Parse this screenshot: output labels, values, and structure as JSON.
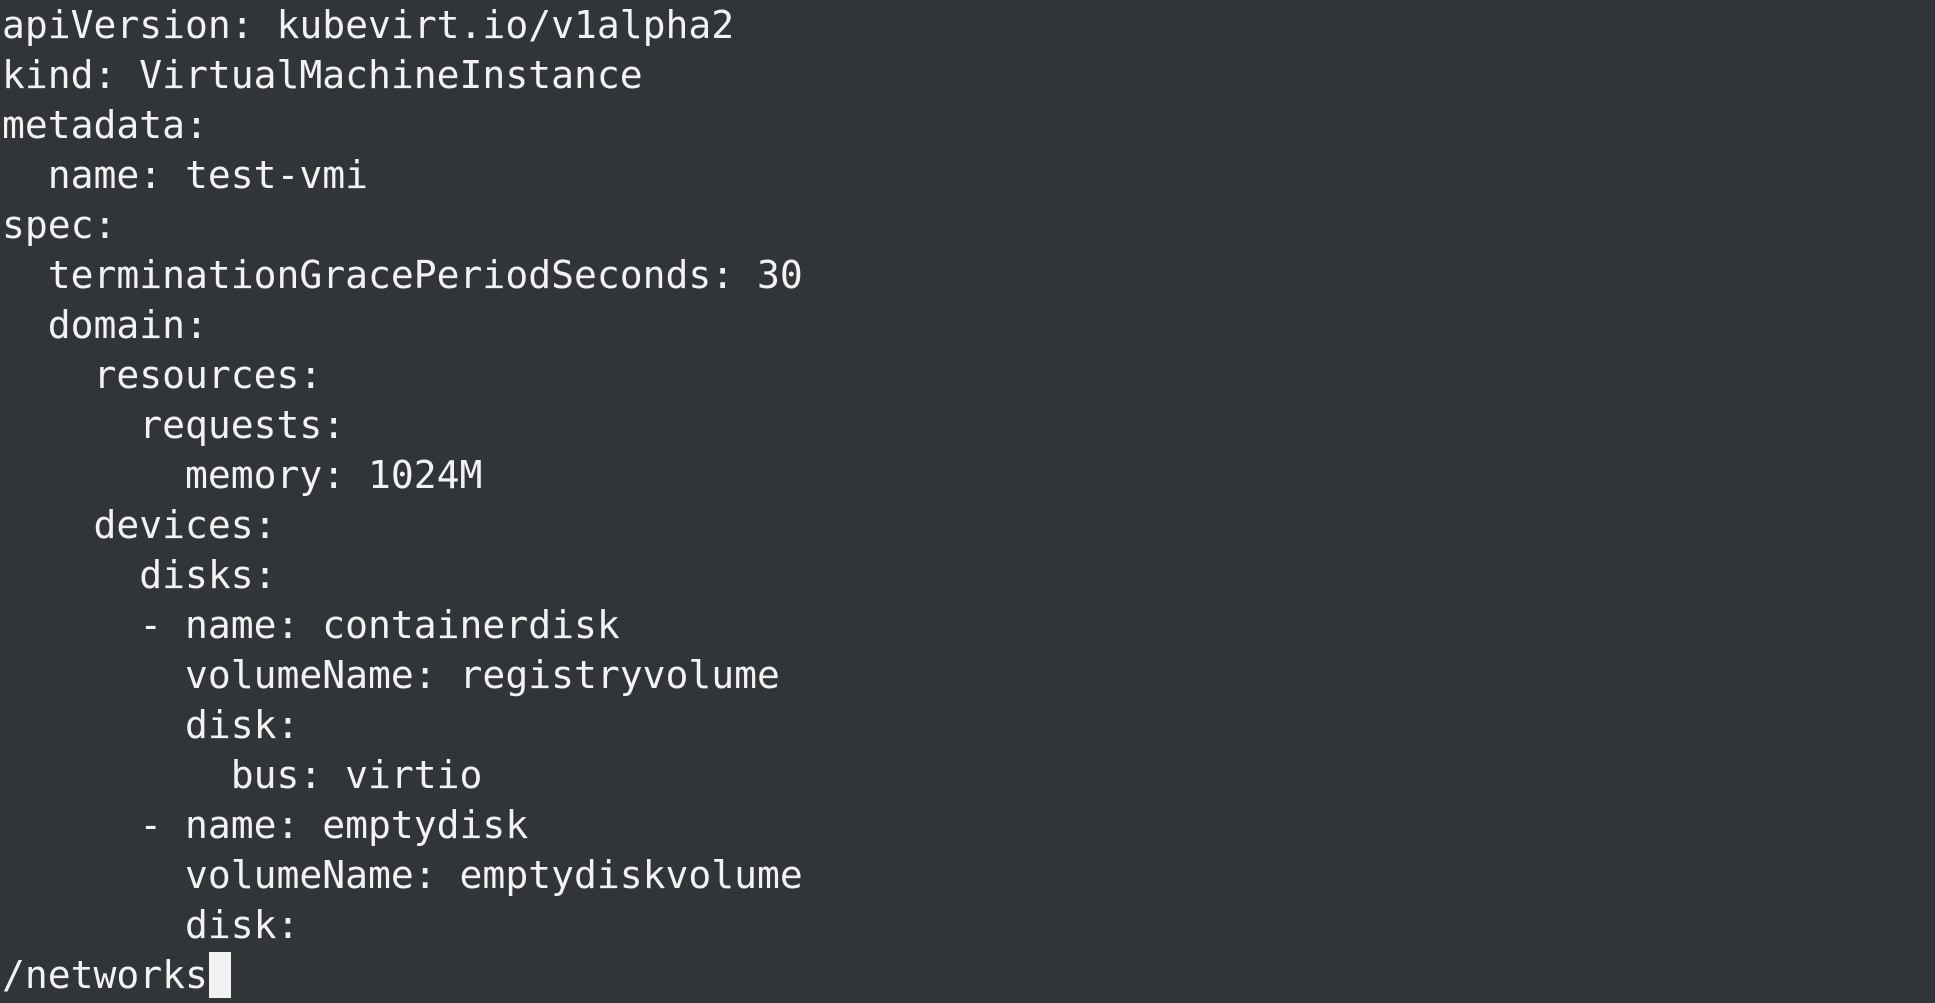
{
  "editor": {
    "lines": [
      "apiVersion: kubevirt.io/v1alpha2",
      "kind: VirtualMachineInstance",
      "metadata:",
      "  name: test-vmi",
      "spec:",
      "  terminationGracePeriodSeconds: 30",
      "  domain:",
      "    resources:",
      "      requests:",
      "        memory: 1024M",
      "    devices:",
      "      disks:",
      "      - name: containerdisk",
      "        volumeName: registryvolume",
      "        disk:",
      "          bus: virtio",
      "      - name: emptydisk",
      "        volumeName: emptydiskvolume",
      "        disk:"
    ]
  },
  "command_line": {
    "text": "/networks"
  }
}
